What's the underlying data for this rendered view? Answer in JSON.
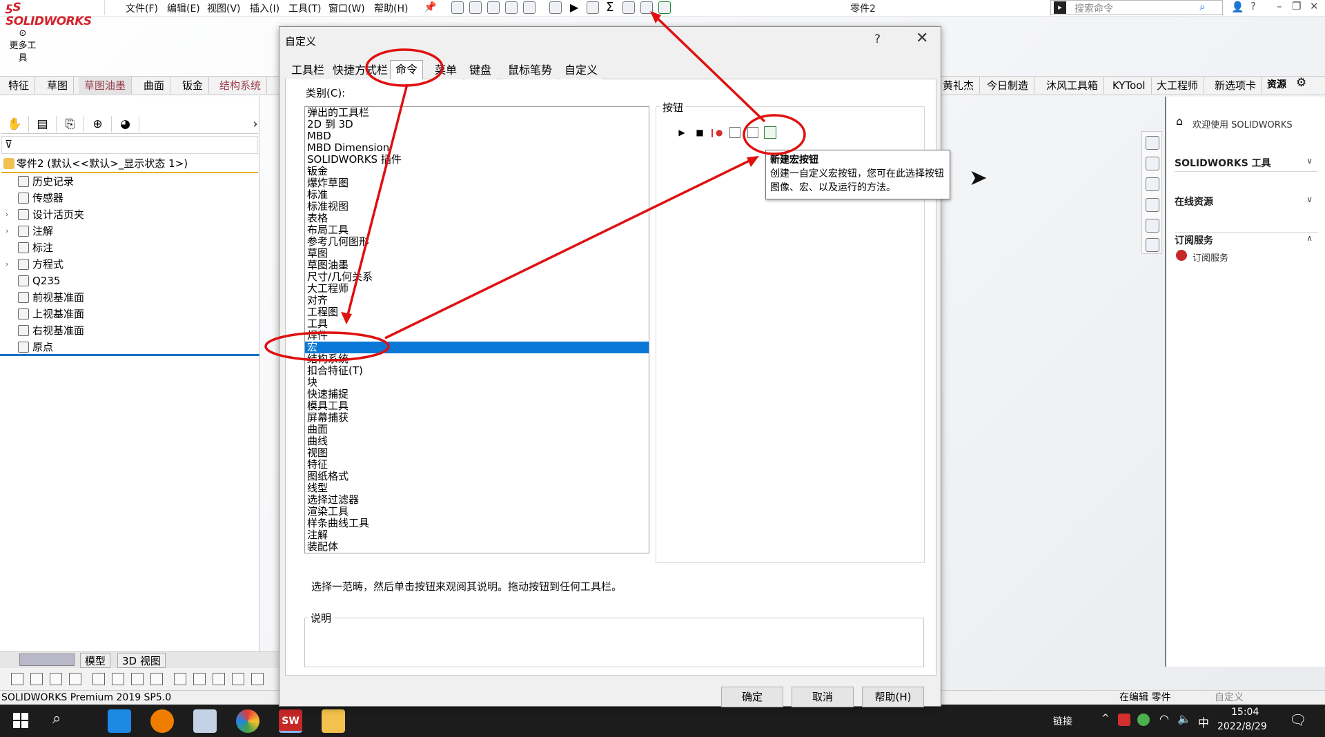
{
  "app": {
    "logo_text": "SOLIDWORKS",
    "document_title": "零件2",
    "menus": [
      "文件(F)",
      "编辑(E)",
      "视图(V)",
      "插入(I)",
      "工具(T)",
      "窗口(W)",
      "帮助(H)"
    ],
    "search_placeholder": "搜索命令"
  },
  "left_toolbar": {
    "more_tools_label": "更多工具"
  },
  "command_tabs": [
    "特征",
    "草图",
    "草图油墨",
    "曲面",
    "钣金",
    "结构系统"
  ],
  "command_tabs_right": [
    "黄礼杰",
    "今日制造",
    "沐风工具箱",
    "KYTool",
    "大工程师",
    "新选项卡"
  ],
  "feature_tree": {
    "root": "零件2 (默认<<默认>_显示状态 1>)",
    "items": [
      {
        "label": "历史记录",
        "expandable": false
      },
      {
        "label": "传感器",
        "expandable": false
      },
      {
        "label": "设计活页夹",
        "expandable": true
      },
      {
        "label": "注解",
        "expandable": true
      },
      {
        "label": "标注",
        "expandable": false
      },
      {
        "label": "方程式",
        "expandable": true
      },
      {
        "label": "Q235",
        "expandable": false
      },
      {
        "label": "前视基准面",
        "expandable": false
      },
      {
        "label": "上视基准面",
        "expandable": false
      },
      {
        "label": "右视基准面",
        "expandable": false
      },
      {
        "label": "原点",
        "expandable": false
      }
    ]
  },
  "model_tabs": [
    "模型",
    "3D 视图"
  ],
  "status": {
    "product": "SOLIDWORKS Premium 2019 SP5.0",
    "editing": "在编辑 零件",
    "customize": "自定义"
  },
  "dialog": {
    "title": "自定义",
    "help_glyph": "?",
    "close_glyph": "✕",
    "tabs": [
      "工具栏",
      "快捷方式栏",
      "命令",
      "菜单",
      "键盘",
      "鼠标笔势",
      "自定义"
    ],
    "active_tab": "命令",
    "category_label": "类别(C):",
    "categories": [
      "弹出的工具栏",
      "2D 到 3D",
      "MBD",
      "MBD Dimension",
      "SOLIDWORKS 插件",
      "钣金",
      "爆炸草图",
      "标准",
      "标准视图",
      "表格",
      "布局工具",
      "参考几何图形",
      "草图",
      "草图油墨",
      "尺寸/几何关系",
      "大工程师",
      "对齐",
      "工程图",
      "工具",
      "焊件",
      "宏",
      "结构系统",
      "扣合特征(T)",
      "块",
      "快速捕捉",
      "模具工具",
      "屏幕捕获",
      "曲面",
      "曲线",
      "视图",
      "特征",
      "图纸格式",
      "线型",
      "选择过滤器",
      "渲染工具",
      "样条曲线工具",
      "注解",
      "装配体"
    ],
    "selected_category": "宏",
    "buttons_label": "按钮",
    "hint_text": "选择一范畴，然后单击按钮来观阅其说明。拖动按钮到任何工具栏。",
    "description_label": "说明",
    "ok_label": "确定",
    "cancel_label": "取消",
    "help_label": "帮助(H)"
  },
  "tooltip": {
    "title": "新建宏按钮",
    "body": "创建一自定义宏按钮，您可在此选择按钮图像、宏、以及运行的方法。"
  },
  "resources": {
    "tab_label": "资源",
    "welcome": "欢迎使用 SOLIDWORKS",
    "sections": [
      {
        "label": "SOLIDWORKS 工具",
        "chevron": "∨"
      },
      {
        "label": "在线资源",
        "chevron": "∨"
      },
      {
        "label": "订阅服务",
        "chevron": "∧"
      }
    ],
    "subscription_item": "订阅服务"
  },
  "taskbar": {
    "links_label": "链接",
    "ime": "中",
    "time": "15:04",
    "date": "2022/8/29"
  },
  "colors": {
    "selection_blue": "#0a78d7",
    "annotation_red": "#e01010",
    "brand_red": "#d4232b",
    "tree_accent": "#e0b000"
  }
}
